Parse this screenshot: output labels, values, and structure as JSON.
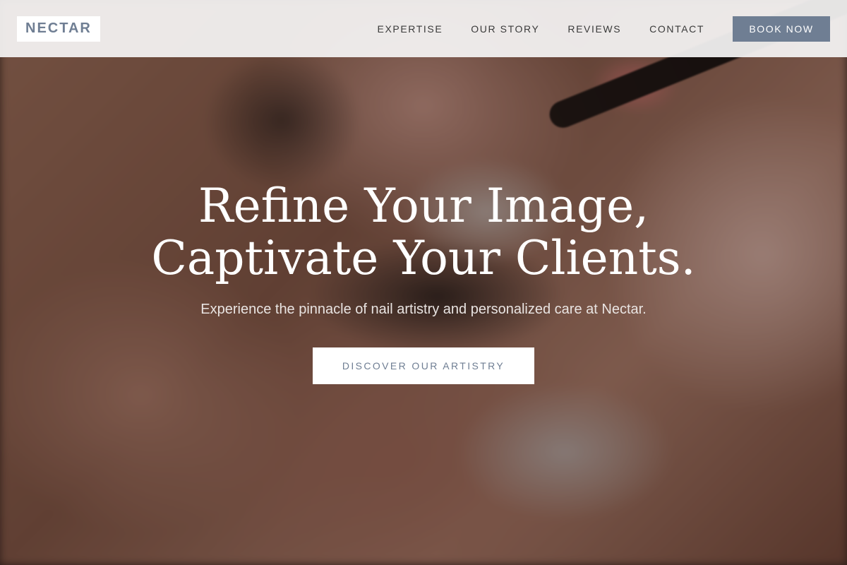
{
  "header": {
    "logo_text": "NECTAR",
    "nav": [
      {
        "label": "EXPERTISE"
      },
      {
        "label": "OUR STORY"
      },
      {
        "label": "REVIEWS"
      },
      {
        "label": "CONTACT"
      }
    ],
    "book_label": "BOOK NOW"
  },
  "hero": {
    "title_line1": "Refine Your Image,",
    "title_line2": "Captivate Your Clients.",
    "subtitle": "Experience the pinnacle of nail artistry and personalized care at Nectar.",
    "cta_label": "DISCOVER OUR ARTISTRY"
  },
  "colors": {
    "accent": "#6f7e93",
    "header_bg": "#f5f4f4",
    "text_light": "#ffffff"
  }
}
